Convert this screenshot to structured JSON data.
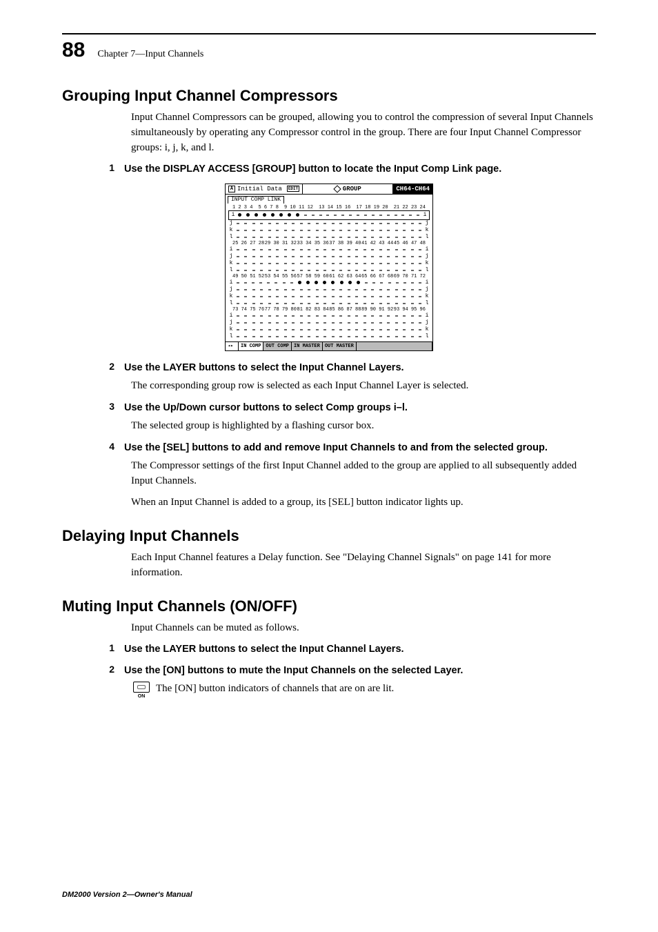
{
  "page_number": "88",
  "chapter_label": "Chapter 7—Input Channels",
  "section1": {
    "title": "Grouping Input Channel Compressors",
    "intro": "Input Channel Compressors can be grouped, allowing you to control the compression of several Input Channels simultaneously by operating any Compressor control in the group. There are four Input Channel Compressor groups: i, j, k, and l.",
    "steps": [
      {
        "n": "1",
        "text": "Use the DISPLAY ACCESS [GROUP] button to locate the Input Comp Link page."
      },
      {
        "n": "2",
        "text": "Use the LAYER buttons to select the Input Channel Layers."
      },
      {
        "n": "3",
        "text": "Use the Up/Down cursor buttons to select Comp groups i–l."
      },
      {
        "n": "4",
        "text": "Use the [SEL] buttons to add and remove Input Channels to and from the selected group."
      }
    ],
    "after2": "The corresponding group row is selected as each Input Channel Layer is selected.",
    "after3": "The selected group is highlighted by a flashing cursor box.",
    "after4a": "The Compressor settings of the first Input Channel added to the group are applied to all subsequently added Input Channels.",
    "after4b": "When an Input Channel is added to a group, its [SEL] button indicator lights up."
  },
  "screenshot": {
    "title_left_icon": "A",
    "title_left": "Initial Data",
    "title_mid_edit": "EDIT",
    "title_mid": "GROUP",
    "title_right": "CH64-CH64",
    "tab_label": "INPUT COMP LINK",
    "blocks": [
      {
        "headers": [
          "1 2 3 4",
          "5 6 7 8",
          "9 10 11 12",
          "13 14 15 16",
          "17 18 19 20",
          "21 22 23 24"
        ],
        "rows": [
          {
            "label_l": "i",
            "label_r": "i",
            "fill": [
              [
                0,
                0
              ],
              [
                0,
                1
              ],
              [
                0,
                2
              ],
              [
                0,
                3
              ],
              [
                1,
                0
              ],
              [
                1,
                1
              ],
              [
                1,
                2
              ],
              [
                1,
                3
              ]
            ]
          },
          {
            "label_l": "j",
            "label_r": "j",
            "fill": []
          },
          {
            "label_l": "k",
            "label_r": "k",
            "fill": []
          },
          {
            "label_l": "l",
            "label_r": "l",
            "fill": []
          }
        ]
      },
      {
        "headers": [
          "25 26 27 28",
          "29 30 31 32",
          "33 34 35 36",
          "37 38 39 40",
          "41 42 43 44",
          "45 46 47 48"
        ],
        "rows": [
          {
            "label_l": "i",
            "label_r": "i",
            "fill": []
          },
          {
            "label_l": "j",
            "label_r": "j",
            "fill": []
          },
          {
            "label_l": "k",
            "label_r": "k",
            "fill": []
          },
          {
            "label_l": "l",
            "label_r": "l",
            "fill": []
          }
        ]
      },
      {
        "headers": [
          "49 50 51 52",
          "53 54 55 56",
          "57 58 59 60",
          "61 62 63 64",
          "65 66 67 68",
          "69 70 71 72"
        ],
        "rows": [
          {
            "label_l": "i",
            "label_r": "i",
            "fill": [
              [
                2,
                0
              ],
              [
                2,
                1
              ],
              [
                2,
                2
              ],
              [
                2,
                3
              ],
              [
                3,
                0
              ],
              [
                3,
                1
              ],
              [
                3,
                2
              ],
              [
                3,
                3
              ]
            ]
          },
          {
            "label_l": "j",
            "label_r": "j",
            "fill": []
          },
          {
            "label_l": "k",
            "label_r": "k",
            "fill": []
          },
          {
            "label_l": "l",
            "label_r": "l",
            "fill": []
          }
        ]
      },
      {
        "headers": [
          "73 74 75 76",
          "77 78 79 80",
          "81 82 83 84",
          "85 86 87 88",
          "89 90 91 92",
          "93 94 95 96"
        ],
        "rows": [
          {
            "label_l": "i",
            "label_r": "i",
            "fill": []
          },
          {
            "label_l": "j",
            "label_r": "j",
            "fill": []
          },
          {
            "label_l": "k",
            "label_r": "k",
            "fill": []
          },
          {
            "label_l": "l",
            "label_r": "l",
            "fill": []
          }
        ]
      }
    ],
    "bottom_tabs": [
      "IN COMP",
      "OUT COMP",
      "IN MASTER",
      "OUT MASTER"
    ]
  },
  "section2": {
    "title": "Delaying Input Channels",
    "body": "Each Input Channel features a Delay function. See \"Delaying Channel Signals\" on page 141 for more information."
  },
  "section3": {
    "title": "Muting Input Channels (ON/OFF)",
    "intro": "Input Channels can be muted as follows.",
    "steps": [
      {
        "n": "1",
        "text": "Use the LAYER buttons to select the Input Channel Layers."
      },
      {
        "n": "2",
        "text": "Use the [ON] buttons to mute the Input Channels on the selected Layer."
      }
    ],
    "on_text": "The [ON] button indicators of channels that are on are lit.",
    "on_label": "ON"
  },
  "footer": "DM2000 Version 2—Owner's Manual"
}
